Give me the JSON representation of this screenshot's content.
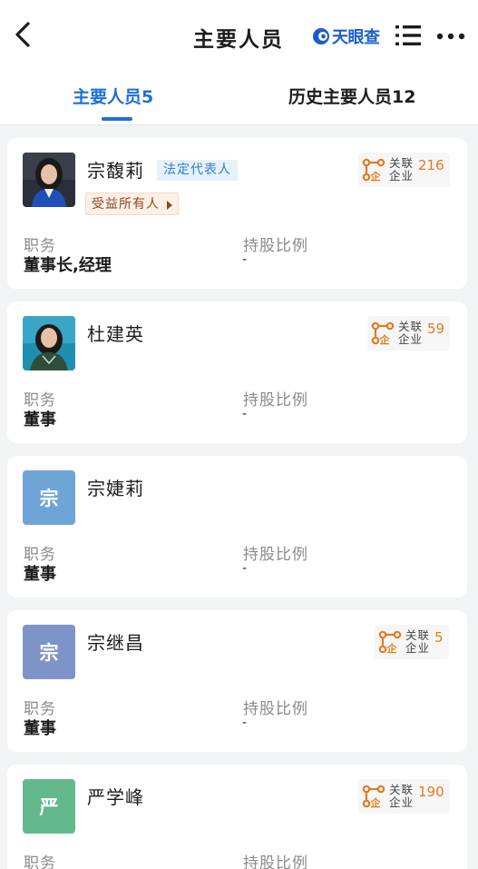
{
  "header": {
    "title": "主要人员",
    "brand": "天眼查",
    "back_icon": "chevron-left-icon",
    "list_icon": "list-icon",
    "more_icon": "more-dots-icon"
  },
  "tabs": [
    {
      "label": "主要人员5",
      "active": true
    },
    {
      "label": "历史主要人员12",
      "active": false
    }
  ],
  "labels": {
    "position": "职务",
    "share_ratio": "持股比例",
    "related": "关联企业",
    "legal_rep": "法定代表人",
    "beneficial_owner": "受益所有人"
  },
  "people": [
    {
      "name": "宗馥莉",
      "avatar": "photo",
      "legal_rep": true,
      "beneficial_owner": true,
      "related_count": "216",
      "position": "董事长,经理",
      "share": "-"
    },
    {
      "name": "杜建英",
      "avatar": "photo",
      "legal_rep": false,
      "beneficial_owner": false,
      "related_count": "59",
      "position": "董事",
      "share": "-"
    },
    {
      "name": "宗婕莉",
      "avatar": "letter",
      "avatar_letter": "宗",
      "avatar_color": "#6fa4d6",
      "legal_rep": false,
      "beneficial_owner": false,
      "related_count": null,
      "position": "董事",
      "share": "-"
    },
    {
      "name": "宗继昌",
      "avatar": "letter",
      "avatar_letter": "宗",
      "avatar_color": "#7e94c9",
      "legal_rep": false,
      "beneficial_owner": false,
      "related_count": "5",
      "position": "董事",
      "share": "-"
    },
    {
      "name": "严学峰",
      "avatar": "letter",
      "avatar_letter": "严",
      "avatar_color": "#63b98c",
      "legal_rep": false,
      "beneficial_owner": false,
      "related_count": "190",
      "position": "",
      "share": ""
    }
  ],
  "colors": {
    "accent": "#1f6fd6",
    "related_count": "#e07b22",
    "related_icon": "#e07b22"
  }
}
